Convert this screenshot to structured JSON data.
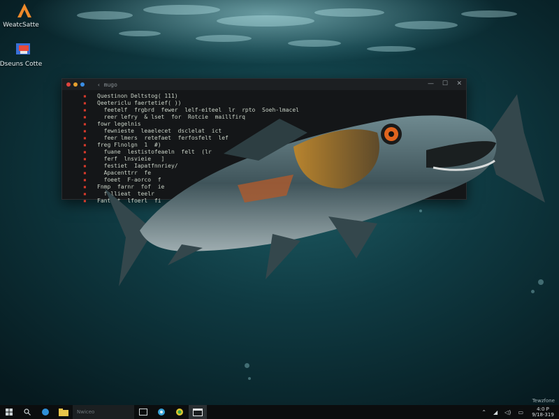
{
  "desktop": {
    "icons": [
      {
        "label": "WeatcSatte",
        "icon": "app-a-icon"
      },
      {
        "label": "Dseuns Cotte",
        "icon": "document-app-icon"
      }
    ],
    "corner_text": "Tewzfone"
  },
  "terminal": {
    "title": "‹ mugo",
    "controls": {
      "minimize": "—",
      "maximize": "☐",
      "close": "✕"
    },
    "lines": [
      "Questinon Deltstog( 111)",
      "Qeetericlu faertetief( ))",
      "  feetelf  frgbrd  fewer  lelf-eiteel  lr  rpto  Soeh-lmacel",
      "  reer lefry  & lset  for  Rotcie  maillfirq",
      "fowr legelnis",
      "  fewnieste  leaelecet  dsclelat  ict",
      "  feer lmers  retefaet  ferfosfelt  lef",
      "freg Flnolgn  1  #)",
      "  fuane  lestistofeaeln  felt  (lr",
      "  ferf  lnsvieie   ]",
      "  festiet  Iapatfnnriey/",
      "  Apacenttrr  fe",
      "  foeet  F-aorco  f",
      "Fnmp  farnr  fof  ie",
      "  fellieat  teelr",
      "Fantast  lfoerl  fi"
    ]
  },
  "taskbar": {
    "search_placeholder": "Nwiceo",
    "clock_time": "4:0 P",
    "clock_date": "9/18-319"
  }
}
